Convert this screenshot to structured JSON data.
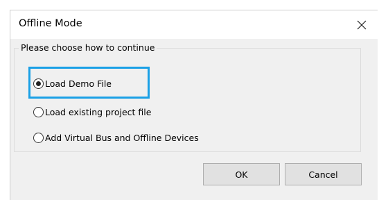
{
  "dialog": {
    "title": "Offline Mode",
    "close_icon": "close-icon"
  },
  "group": {
    "label": "Please choose how to continue",
    "options": [
      {
        "label": "Load Demo File",
        "checked": true
      },
      {
        "label": "Load existing project file",
        "checked": false
      },
      {
        "label": "Add Virtual Bus and Offline Devices",
        "checked": false
      }
    ]
  },
  "buttons": {
    "ok_label": "OK",
    "cancel_label": "Cancel"
  },
  "colors": {
    "highlight": "#1aa0e6",
    "dialog_bg": "#f0f0f0",
    "button_bg": "#e1e1e1"
  }
}
